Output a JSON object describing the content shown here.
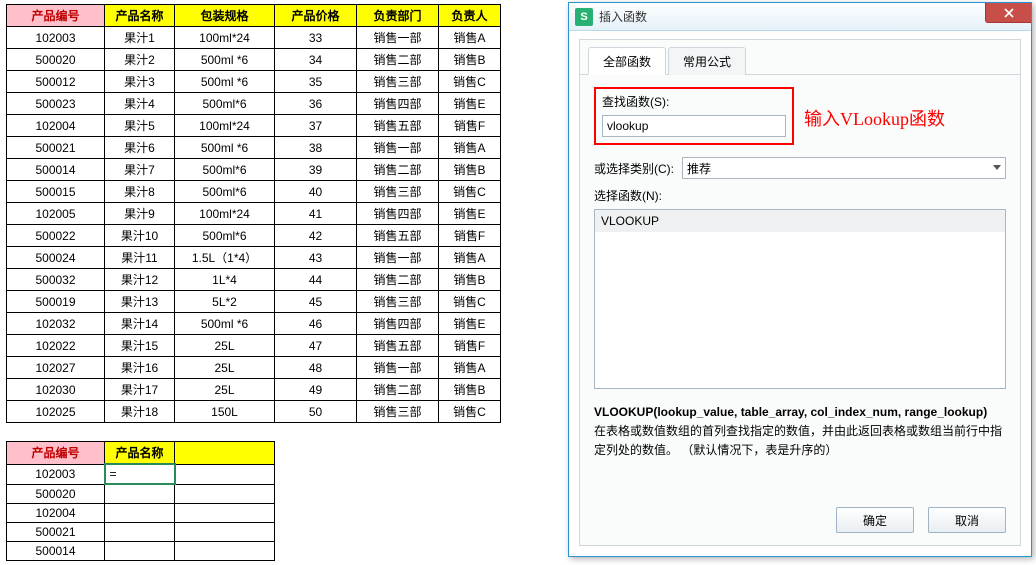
{
  "table": {
    "headers": [
      "产品编号",
      "产品名称",
      "包装规格",
      "产品价格",
      "负责部门",
      "负责人"
    ],
    "rows": [
      [
        "102003",
        "果汁1",
        "100ml*24",
        "33",
        "销售一部",
        "销售A"
      ],
      [
        "500020",
        "果汁2",
        "500ml *6",
        "34",
        "销售二部",
        "销售B"
      ],
      [
        "500012",
        "果汁3",
        "500ml *6",
        "35",
        "销售三部",
        "销售C"
      ],
      [
        "500023",
        "果汁4",
        "500ml*6",
        "36",
        "销售四部",
        "销售E"
      ],
      [
        "102004",
        "果汁5",
        "100ml*24",
        "37",
        "销售五部",
        "销售F"
      ],
      [
        "500021",
        "果汁6",
        "500ml *6",
        "38",
        "销售一部",
        "销售A"
      ],
      [
        "500014",
        "果汁7",
        "500ml*6",
        "39",
        "销售二部",
        "销售B"
      ],
      [
        "500015",
        "果汁8",
        "500ml*6",
        "40",
        "销售三部",
        "销售C"
      ],
      [
        "102005",
        "果汁9",
        "100ml*24",
        "41",
        "销售四部",
        "销售E"
      ],
      [
        "500022",
        "果汁10",
        "500ml*6",
        "42",
        "销售五部",
        "销售F"
      ],
      [
        "500024",
        "果汁11",
        "1.5L（1*4）",
        "43",
        "销售一部",
        "销售A"
      ],
      [
        "500032",
        "果汁12",
        "1L*4",
        "44",
        "销售二部",
        "销售B"
      ],
      [
        "500019",
        "果汁13",
        "5L*2",
        "45",
        "销售三部",
        "销售C"
      ],
      [
        "102032",
        "果汁14",
        "500ml *6",
        "46",
        "销售四部",
        "销售E"
      ],
      [
        "102022",
        "果汁15",
        "25L",
        "47",
        "销售五部",
        "销售F"
      ],
      [
        "102027",
        "果汁16",
        "25L",
        "48",
        "销售一部",
        "销售A"
      ],
      [
        "102030",
        "果汁17",
        "25L",
        "49",
        "销售二部",
        "销售B"
      ],
      [
        "102025",
        "果汁18",
        "150L",
        "50",
        "销售三部",
        "销售C"
      ]
    ]
  },
  "lookup": {
    "headers": [
      "产品编号",
      "产品名称",
      ""
    ],
    "editing_value": "=",
    "ids": [
      "102003",
      "500020",
      "102004",
      "500021",
      "500014"
    ]
  },
  "dialog": {
    "title": "插入函数",
    "tabs": {
      "all": "全部函数",
      "common": "常用公式"
    },
    "search_label": "查找函数(S):",
    "search_value": "vlookup",
    "annotation": "输入VLookup函数",
    "category_label": "或选择类别(C):",
    "category_value": "推荐",
    "selectfn_label": "选择函数(N):",
    "list_item": "VLOOKUP",
    "signature": "VLOOKUP(lookup_value, table_array, col_index_num, range_lookup)",
    "description": "在表格或数值数组的首列查找指定的数值，并由此返回表格或数组当前行中指定列处的数值。 （默认情况下，表是升序的）",
    "ok": "确定",
    "cancel": "取消"
  }
}
